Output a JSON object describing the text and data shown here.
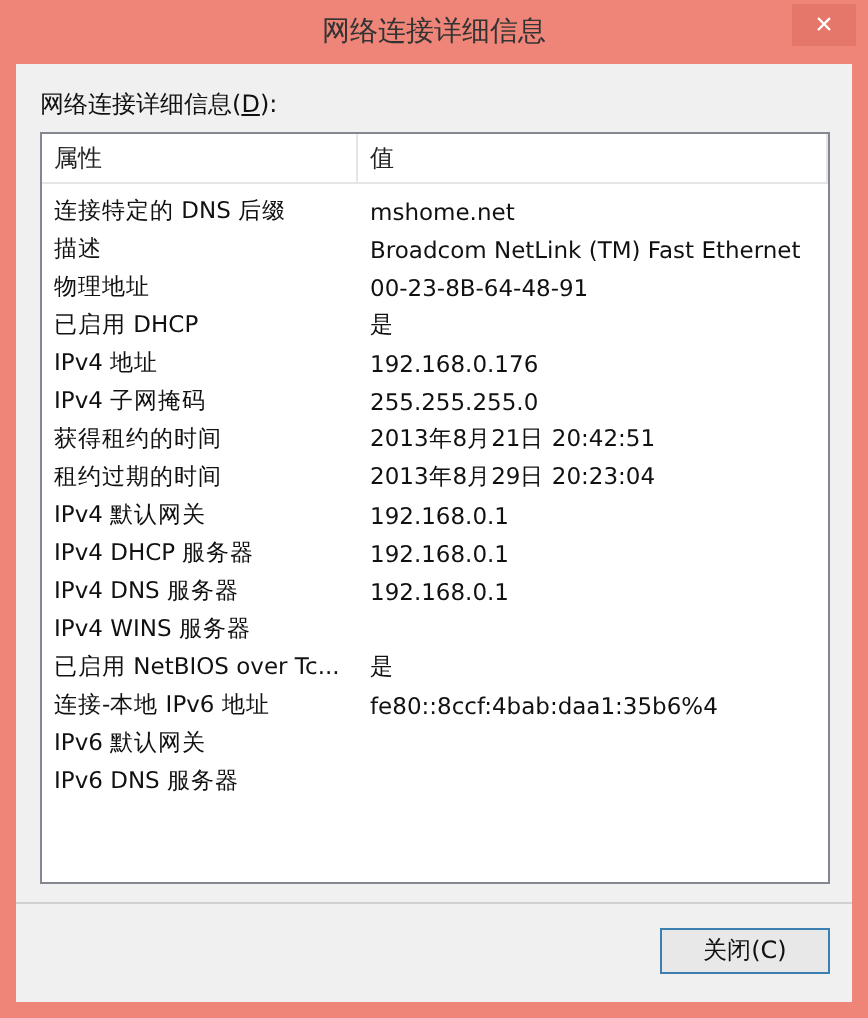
{
  "window": {
    "title": "网络连接详细信息",
    "close": "×"
  },
  "list_label": "网络连接详细信息(**D**):",
  "table": {
    "columns": [
      "属性",
      "值"
    ],
    "rows": [
      [
        "连接特定的 DNS 后缀",
        "mshome.net"
      ],
      [
        "描述",
        "Broadcom NetLink (TM) Fast Ethernet"
      ],
      [
        "物理地址",
        "00-23-8B-64-48-91"
      ],
      [
        "已启用 DHCP",
        "是"
      ],
      [
        "IPv4 地址",
        "192.168.0.176"
      ],
      [
        "IPv4 子网掩码",
        "255.255.255.0"
      ],
      [
        "获得租约的时间",
        "2013年8月21日 20:42:51"
      ],
      [
        "租约过期的时间",
        "2013年8月29日 20:23:04"
      ],
      [
        "IPv4 默认网关",
        "192.168.0.1"
      ],
      [
        "IPv4 DHCP 服务器",
        "192.168.0.1"
      ],
      [
        "IPv4 DNS 服务器",
        "192.168.0.1"
      ],
      [
        "IPv4 WINS 服务器",
        ""
      ],
      [
        "已启用 NetBIOS over Tc...",
        "是"
      ],
      [
        "连接-本地 IPv6 地址",
        "fe80::8ccf:4bab:daa1:35b6%4"
      ],
      [
        "IPv6 默认网关",
        ""
      ],
      [
        "IPv6 DNS 服务器",
        ""
      ]
    ]
  },
  "buttons": [
    "关闭(C)"
  ]
}
